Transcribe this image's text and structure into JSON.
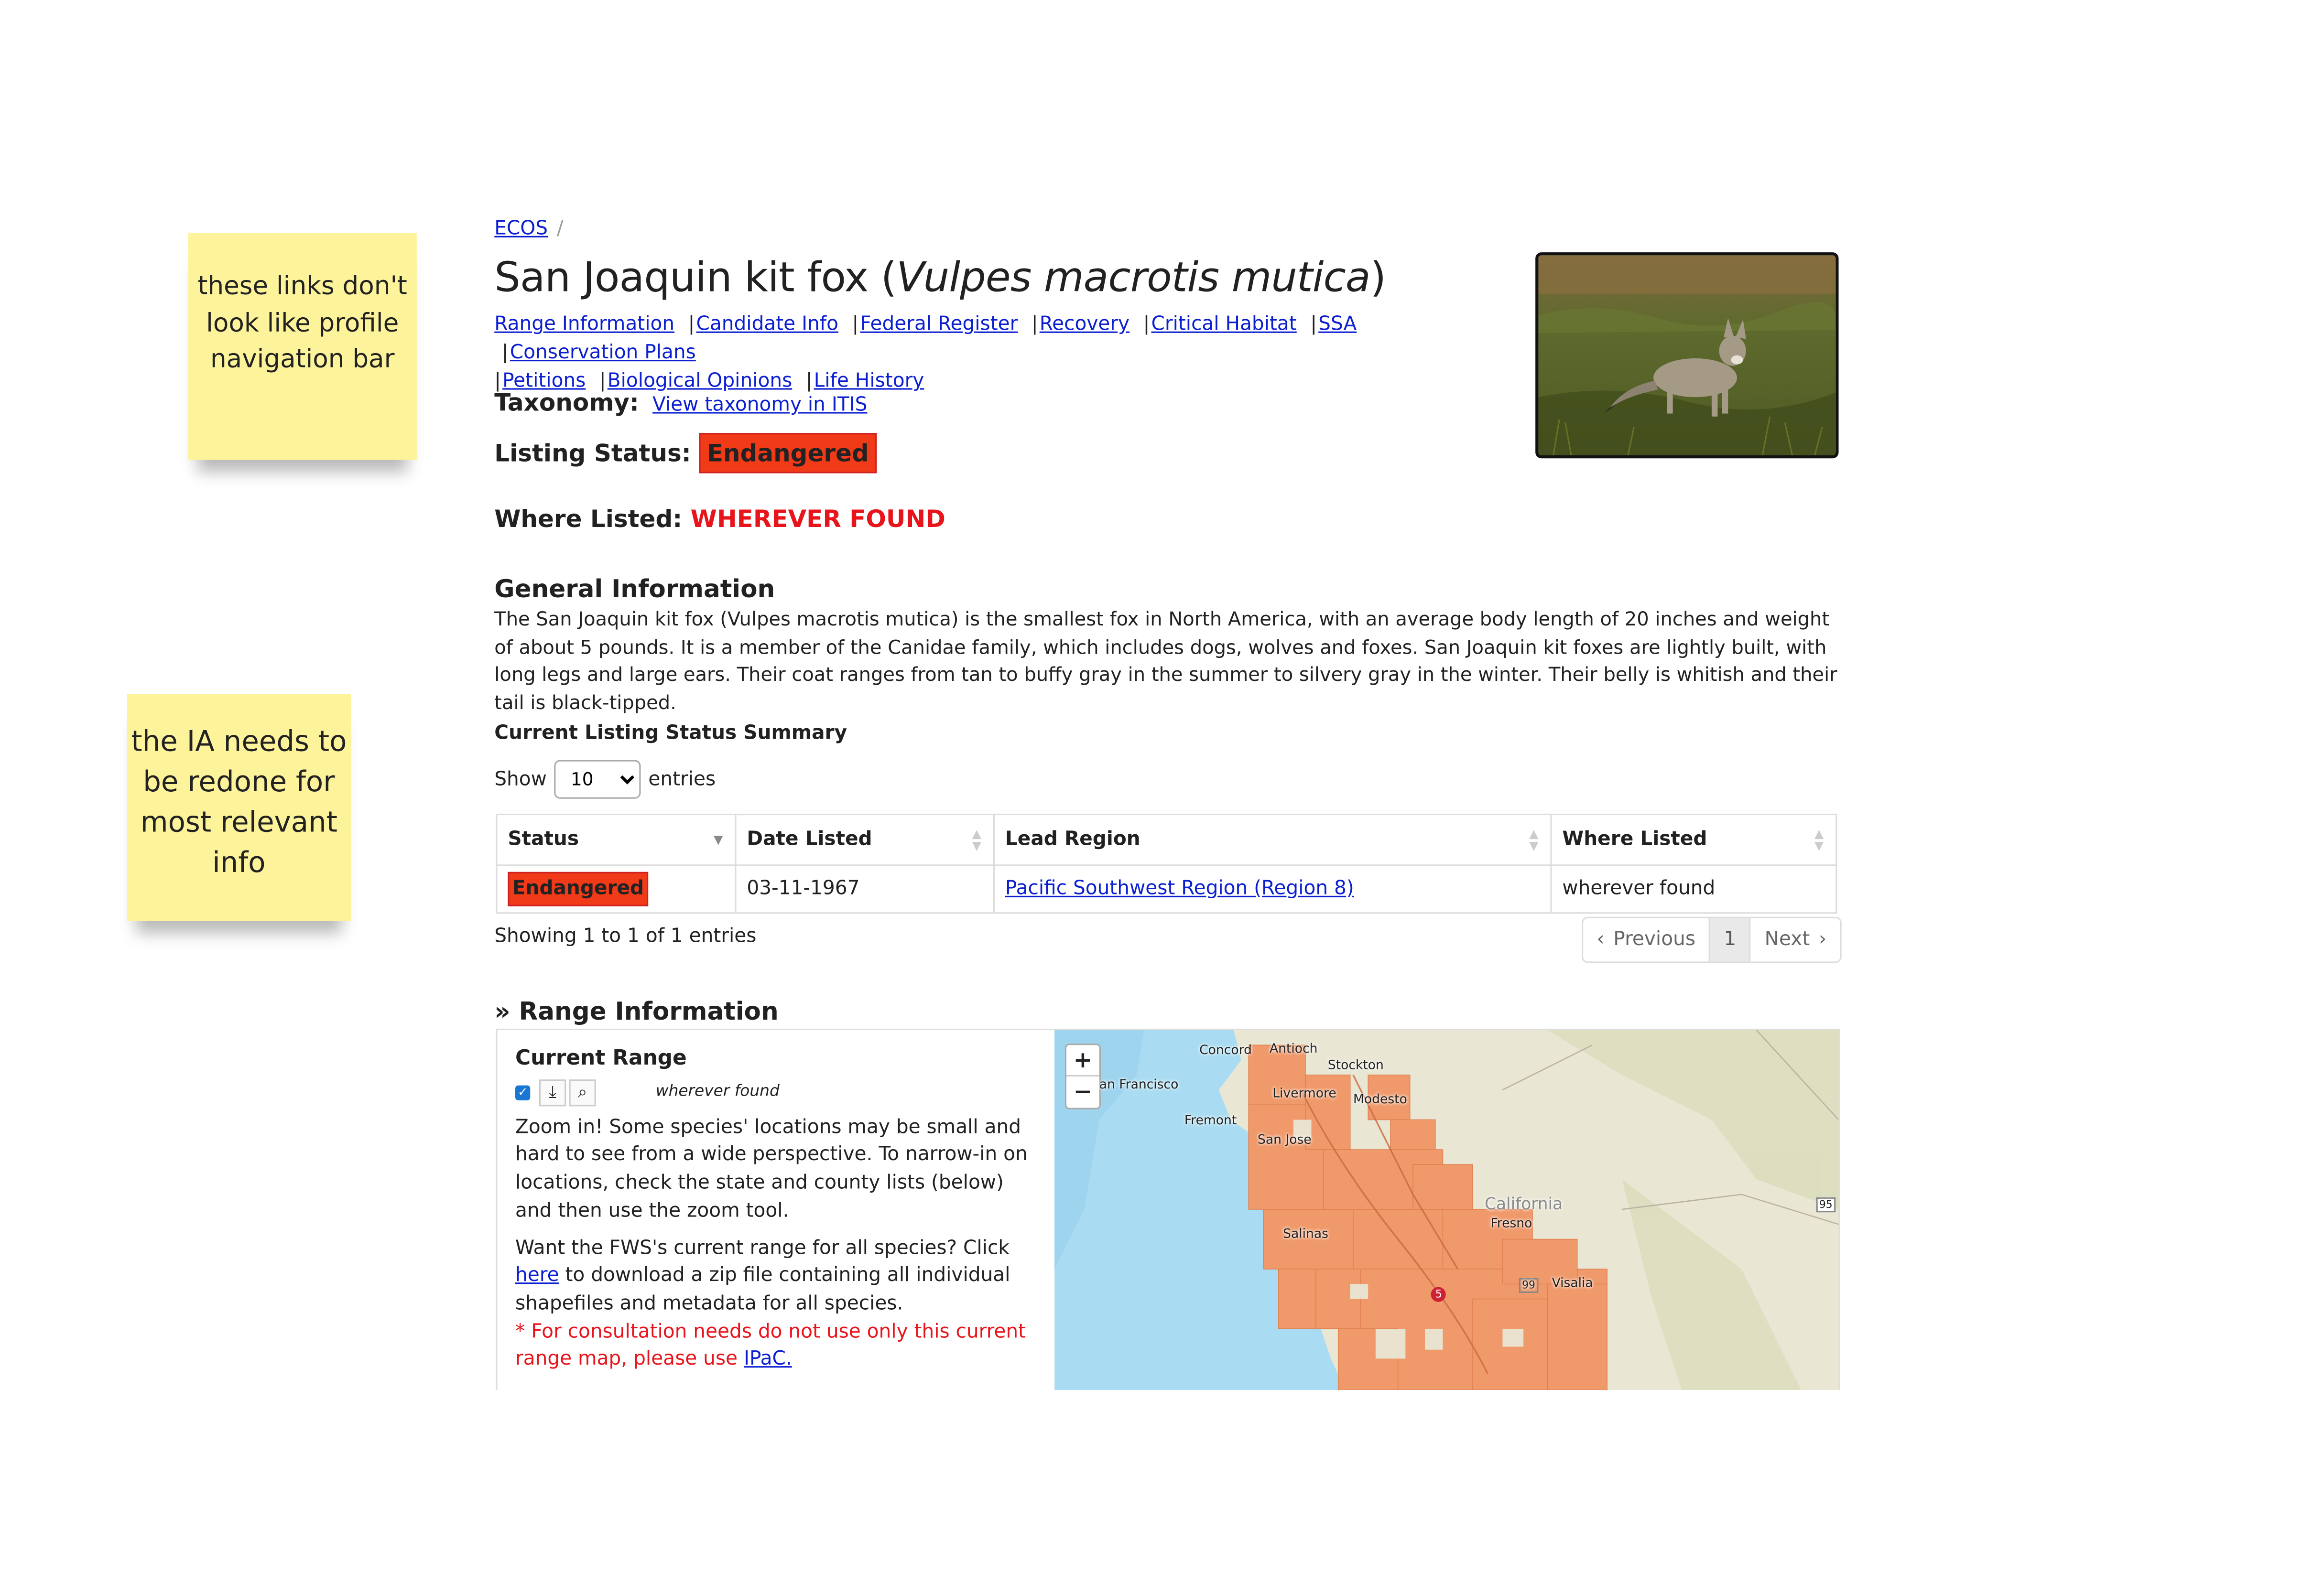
{
  "notes": {
    "note1": "these links don't look like profile navigation bar",
    "note2": "the IA needs to be redone for most relevant info"
  },
  "breadcrumb": {
    "home": "ECOS",
    "separator": "/"
  },
  "species": {
    "common_name": "San Joaquin kit fox",
    "scientific_name": "Vulpes macrotis mutica"
  },
  "nav_links": [
    "Range Information",
    "Candidate Info",
    "Federal Register",
    "Recovery",
    "Critical Habitat",
    "SSA",
    "Conservation Plans",
    "Petitions",
    "Biological Opinions",
    "Life History"
  ],
  "taxonomy": {
    "label": "Taxonomy:",
    "link": "View taxonomy in ITIS"
  },
  "listing_status": {
    "label": "Listing Status:",
    "value": "Endangered"
  },
  "where_listed": {
    "label": "Where Listed:",
    "value": "WHEREVER FOUND"
  },
  "general_info": {
    "heading": "General Information",
    "text": "The San Joaquin kit fox (Vulpes macrotis mutica) is the smallest fox in North America, with an average body length of 20 inches and weight of about 5 pounds. It is a member of the Canidae family, which includes dogs, wolves and foxes. San Joaquin kit foxes are lightly built, with long legs and large ears. Their coat ranges from tan to buffy gray in the summer to silvery gray in the winter. Their belly is whitish and their tail is black-tipped."
  },
  "status_summary": {
    "heading": "Current Listing Status Summary",
    "show_label": "Show",
    "entries_label": "entries",
    "page_size": "10",
    "columns": [
      "Status",
      "Date Listed",
      "Lead Region",
      "Where Listed"
    ],
    "rows": [
      {
        "status": "Endangered",
        "date_listed": "03-11-1967",
        "lead_region": "Pacific Southwest Region (Region 8)",
        "where_listed": "wherever found"
      }
    ],
    "showing_text": "Showing 1 to 1 of 1 entries",
    "pagination": {
      "previous": "Previous",
      "current": "1",
      "next": "Next"
    }
  },
  "range": {
    "heading": "» Range Information",
    "current_range_title": "Current Range",
    "layer_label": "wherever found",
    "zoom_text": "Zoom in! Some species' locations may be small and hard to see from a wide perspective. To narrow-in on locations, check the state and county lists (below) and then use the zoom tool.",
    "fws_text_before": "Want the FWS's current range for all species? Click",
    "fws_link": "here",
    "fws_text_after": "to download a zip file containing all individual shapefiles and metadata for all species.",
    "warning_text": "* For consultation needs do not use only this current range map, please use",
    "ipac_link": "IPaC."
  },
  "map": {
    "zoom_in": "+",
    "zoom_out": "−",
    "labels": [
      "Concord",
      "Antioch",
      "Stockton",
      "an Francisco",
      "Livermore",
      "Modesto",
      "Fremont",
      "San Jose",
      "California",
      "Fresno",
      "Salinas",
      "Visalia",
      "95",
      "99",
      "5"
    ],
    "range_color": "#f09a6b",
    "water_color": "#a9dcf2"
  },
  "colors": {
    "link": "#0b1fd1",
    "endangered_badge": "#f03a18",
    "wherever_found": "#e8141b",
    "sticky": "#fdf39a"
  }
}
